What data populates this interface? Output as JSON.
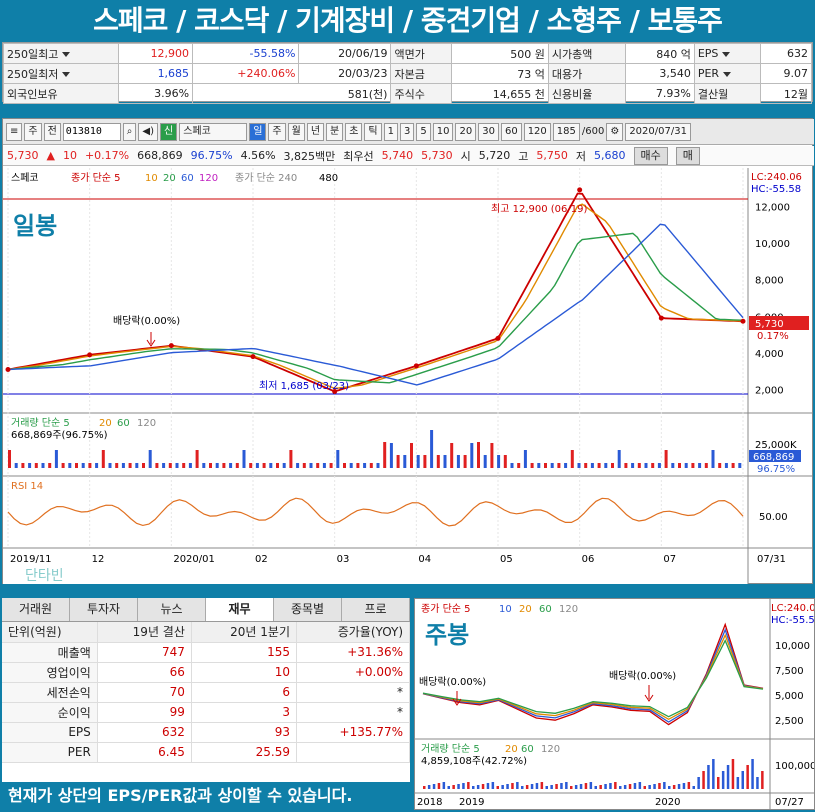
{
  "banner": "스페코 / 코스닥 / 기계장비 / 중견기업 / 소형주 / 보통주",
  "info": {
    "r1": [
      "250일최고",
      "12,900",
      "-55.58%",
      "20/06/19",
      "액면가",
      "500 원",
      "시가총액",
      "840 억",
      "EPS",
      "632"
    ],
    "r2": [
      "250일최저",
      "1,685",
      "+240.06%",
      "20/03/23",
      "자본금",
      "73 억",
      "대용가",
      "3,540",
      "PER",
      "9.07"
    ],
    "r3": [
      "외국인보유",
      "3.96%",
      "581(천)",
      "주식수",
      "14,655 천",
      "신용비율",
      "7.93%",
      "결산월",
      "12월"
    ]
  },
  "toolbar": {
    "type": "주",
    "prefix": "전",
    "code": "013810",
    "badge": "신",
    "name": "스페코",
    "periods": [
      "일",
      "주",
      "월",
      "년",
      "분",
      "초",
      "틱"
    ],
    "nums": [
      "1",
      "3",
      "5",
      "10",
      "20",
      "30",
      "60",
      "120"
    ],
    "count": "185",
    "total": "/600",
    "date": "2020/07/31"
  },
  "quote": {
    "price": "5,730",
    "chg": "10",
    "pct": "+0.17%",
    "vol": "668,869",
    "ratio": "96.75%",
    "turn": "4.56%",
    "amt": "3,825백만",
    "prio_label": "최우선",
    "prio1": "5,740",
    "prio2": "5,730",
    "open_label": "시",
    "open": "5,720",
    "high_label": "고",
    "high": "5,750",
    "low_label": "저",
    "low": "5,680",
    "buy": "매수",
    "sell": "매"
  },
  "chart": {
    "legend_name": "스페코",
    "legend": "종가 단순 5",
    "ma": [
      "10",
      "20",
      "60",
      "120"
    ],
    "legend2": "종가 단순 240",
    "legend3": "480",
    "tag": "일봉",
    "lc": "LC:240.06",
    "hc": "HC:-55.58",
    "high_ann": "최고 12,900 (06/19)",
    "low_ann": "최저 1,685 (03/23)",
    "div_ann": "배당락(0.00%)",
    "last": "5,730",
    "last_pct": "0.17%",
    "yticks": [
      "12,000",
      "10,000",
      "8,000",
      "6,000",
      "4,000",
      "2,000"
    ],
    "vol_title": "거래량 단순 5",
    "vol_ma": [
      "20",
      "60",
      "120"
    ],
    "vol_val": "668,869주(96.75%)",
    "vol_tick": "25,000K",
    "vol_last": "668,869",
    "vol_pct": "96.75%",
    "rsi_title": "RSI 14",
    "rsi_tick": "50.00",
    "xlabels": [
      "2019/11",
      "12",
      "2020/01",
      "02",
      "03",
      "04",
      "05",
      "06",
      "07",
      "07/31"
    ],
    "watermark": "단타빈"
  },
  "chart_data": {
    "type": "line",
    "x": [
      "2019/11",
      "2019/12",
      "2020/01",
      "2020/02",
      "2020/03",
      "2020/04",
      "2020/05",
      "2020/06",
      "2020/07",
      "2020/07/31"
    ],
    "series": [
      {
        "values": [
          3100,
          3900,
          4400,
          3800,
          1900,
          3300,
          4800,
          12900,
          5900,
          5730
        ]
      }
    ],
    "ylim": [
      1000,
      13000
    ]
  },
  "fin": {
    "tabs": [
      "거래원",
      "투자자",
      "뉴스",
      "재무",
      "종목별",
      "프로"
    ],
    "head": [
      "단위(억원)",
      "19년 결산",
      "20년 1분기",
      "증가율(YOY)"
    ],
    "rows": [
      [
        "매출액",
        "747",
        "155",
        "+31.36%"
      ],
      [
        "영업이익",
        "66",
        "10",
        "+0.00%"
      ],
      [
        "세전손익",
        "70",
        "6",
        "*"
      ],
      [
        "순이익",
        "99",
        "3",
        "*"
      ],
      [
        "EPS",
        "632",
        "93",
        "+135.77%"
      ],
      [
        "PER",
        "6.45",
        "25.59",
        ""
      ]
    ],
    "note": "현재가 상단의 EPS/PER값과 상이할 수 있습니다."
  },
  "weekly": {
    "legend": "종가 단순 5",
    "ma": [
      "10",
      "20",
      "60",
      "120"
    ],
    "tag": "주봉",
    "lc": "LC:240.0",
    "hc": "HC:-55.5",
    "div1": "배당락(0.00%)",
    "div2": "배당락(0.00%)",
    "yticks": [
      "10,000",
      "7,500",
      "5,000",
      "2,500"
    ],
    "vol_title": "거래량 단순 5",
    "vol_ma": [
      "20",
      "60",
      "120"
    ],
    "vol_val": "4,859,108주(42.72%)",
    "vol_tick": "100,000",
    "xlabels": [
      "2018",
      "2019",
      "2020",
      "07/27"
    ]
  }
}
